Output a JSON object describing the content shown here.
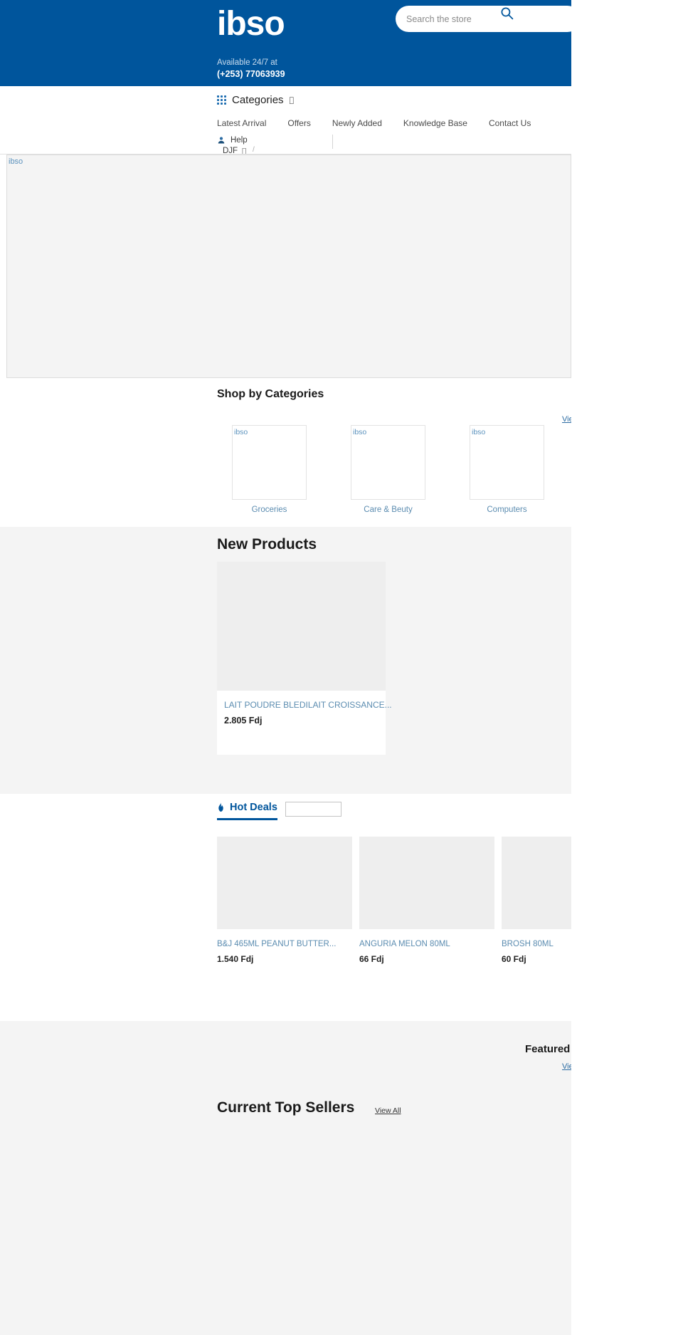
{
  "brand": {
    "name": "ibso",
    "logo_alt": "ibso",
    "header_bg": "#00559c",
    "accent": "#ffe100"
  },
  "search": {
    "placeholder": "Search the store",
    "value": "",
    "icon": "search-icon"
  },
  "contact": {
    "availability_label": "Available 24/7 at",
    "phone": "(+253) 77063939"
  },
  "nav": {
    "categories_label": "Categories",
    "categories_caret": "",
    "links": [
      {
        "label": "Latest Arrival"
      },
      {
        "label": "Offers"
      },
      {
        "label": "Newly Added"
      },
      {
        "label": "Knowledge Base"
      },
      {
        "label": "Contact Us"
      }
    ],
    "help_label": "Help",
    "currency_label": "DJF",
    "currency_caret": "",
    "slash": "/"
  },
  "hero": {
    "alt_text": "ibso"
  },
  "categories_section": {
    "title": "Shop by Categories",
    "view_all": "View All",
    "items": [
      {
        "alt": "ibso",
        "name": "Groceries"
      },
      {
        "alt": "ibso",
        "name": "Care & Beuty"
      },
      {
        "alt": "ibso",
        "name": "Computers"
      }
    ]
  },
  "new_products": {
    "title": "New Products",
    "items": [
      {
        "name": "LAIT POUDRE BLEDILAIT CROISSANCE...",
        "price": "2.805 Fdj"
      }
    ]
  },
  "hot_deals": {
    "tab_label": "Hot Deals",
    "tab_icon": "flame-icon",
    "items": [
      {
        "name": "B&J 465ML PEANUT BUTTER...",
        "price": "1.540 Fdj"
      },
      {
        "name": "ANGURIA MELON 80ML",
        "price": "66 Fdj"
      },
      {
        "name": "BROSH 80ML",
        "price": "60 Fdj"
      }
    ]
  },
  "featured": {
    "title": "Featured",
    "view_all": "View All"
  },
  "top_sellers": {
    "title": "Current Top Sellers",
    "view_all": "View All"
  }
}
